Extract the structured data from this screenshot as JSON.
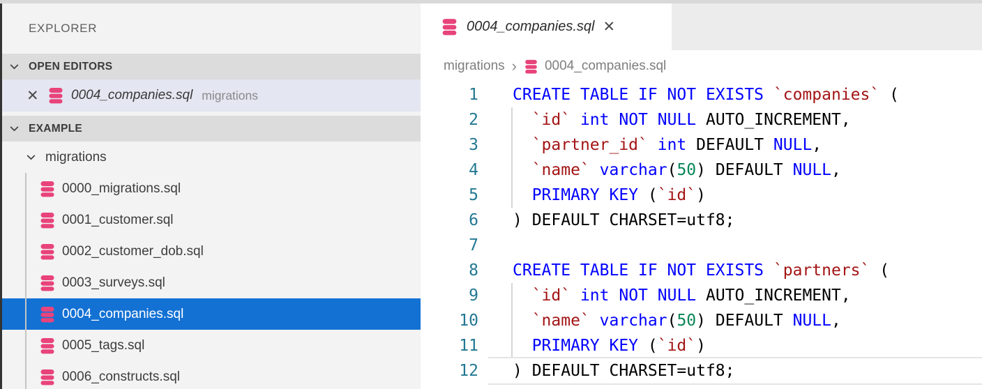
{
  "icons": {
    "close": "✕",
    "chevron_down": "chevron-down",
    "breadcrumb_separator": "›",
    "file_icon": "database-icon"
  },
  "colors": {
    "selection_blue": "#1371d4",
    "open_editor_selection": "#e4e6f1",
    "database_icon_pink": "#e8437a",
    "keyword_blue": "#0000ff",
    "identifier_red": "#a31515",
    "number_green": "#098658",
    "line_number_teal": "#237893",
    "sidebar_bg": "#f3f3f3",
    "section_header_bg": "#dcdcdc",
    "tabstrip_bg": "#ececec"
  },
  "sidebar": {
    "title": "EXPLORER",
    "sections": [
      {
        "label": "OPEN EDITORS"
      },
      {
        "label": "EXAMPLE"
      }
    ],
    "open_editor": {
      "file": "0004_companies.sql",
      "folder": "migrations"
    },
    "tree": {
      "folder": "migrations",
      "selected_index": 4,
      "files": [
        "0000_migrations.sql",
        "0001_customer.sql",
        "0002_customer_dob.sql",
        "0003_surveys.sql",
        "0004_companies.sql",
        "0005_tags.sql",
        "0006_constructs.sql"
      ]
    }
  },
  "editor": {
    "tab": {
      "title": "0004_companies.sql"
    },
    "breadcrumb": {
      "folder": "migrations",
      "separator": "›",
      "file": "0004_companies.sql"
    },
    "code": {
      "lines": [
        {
          "no": "1",
          "guide": false,
          "current": false,
          "tokens": [
            [
              "kw",
              "CREATE TABLE IF NOT EXISTS"
            ],
            [
              "pl",
              " "
            ],
            [
              "id",
              "`companies`"
            ],
            [
              "pl",
              " ("
            ]
          ]
        },
        {
          "no": "2",
          "guide": true,
          "current": false,
          "tokens": [
            [
              "pl",
              "  "
            ],
            [
              "id",
              "`id`"
            ],
            [
              "pl",
              " "
            ],
            [
              "kw",
              "int"
            ],
            [
              "pl",
              " "
            ],
            [
              "kw",
              "NOT NULL"
            ],
            [
              "pl",
              " AUTO_INCREMENT,"
            ]
          ]
        },
        {
          "no": "3",
          "guide": true,
          "current": false,
          "tokens": [
            [
              "pl",
              "  "
            ],
            [
              "id",
              "`partner_id`"
            ],
            [
              "pl",
              " "
            ],
            [
              "kw",
              "int"
            ],
            [
              "pl",
              " DEFAULT "
            ],
            [
              "kw",
              "NULL"
            ],
            [
              "pl",
              ","
            ]
          ]
        },
        {
          "no": "4",
          "guide": true,
          "current": false,
          "tokens": [
            [
              "pl",
              "  "
            ],
            [
              "id",
              "`name`"
            ],
            [
              "pl",
              " "
            ],
            [
              "kw",
              "varchar"
            ],
            [
              "pl",
              "("
            ],
            [
              "num",
              "50"
            ],
            [
              "pl",
              ") DEFAULT "
            ],
            [
              "kw",
              "NULL"
            ],
            [
              "pl",
              ","
            ]
          ]
        },
        {
          "no": "5",
          "guide": true,
          "current": false,
          "tokens": [
            [
              "pl",
              "  "
            ],
            [
              "kw",
              "PRIMARY KEY"
            ],
            [
              "pl",
              " ("
            ],
            [
              "id",
              "`id`"
            ],
            [
              "pl",
              ")"
            ]
          ]
        },
        {
          "no": "6",
          "guide": false,
          "current": false,
          "tokens": [
            [
              "pl",
              ") DEFAULT CHARSET=utf8;"
            ]
          ]
        },
        {
          "no": "7",
          "guide": false,
          "current": false,
          "tokens": []
        },
        {
          "no": "8",
          "guide": false,
          "current": false,
          "tokens": [
            [
              "kw",
              "CREATE TABLE IF NOT EXISTS"
            ],
            [
              "pl",
              " "
            ],
            [
              "id",
              "`partners`"
            ],
            [
              "pl",
              " ("
            ]
          ]
        },
        {
          "no": "9",
          "guide": true,
          "current": false,
          "tokens": [
            [
              "pl",
              "  "
            ],
            [
              "id",
              "`id`"
            ],
            [
              "pl",
              " "
            ],
            [
              "kw",
              "int"
            ],
            [
              "pl",
              " "
            ],
            [
              "kw",
              "NOT NULL"
            ],
            [
              "pl",
              " AUTO_INCREMENT,"
            ]
          ]
        },
        {
          "no": "10",
          "guide": true,
          "current": false,
          "tokens": [
            [
              "pl",
              "  "
            ],
            [
              "id",
              "`name`"
            ],
            [
              "pl",
              " "
            ],
            [
              "kw",
              "varchar"
            ],
            [
              "pl",
              "("
            ],
            [
              "num",
              "50"
            ],
            [
              "pl",
              ") DEFAULT "
            ],
            [
              "kw",
              "NULL"
            ],
            [
              "pl",
              ","
            ]
          ]
        },
        {
          "no": "11",
          "guide": true,
          "current": false,
          "tokens": [
            [
              "pl",
              "  "
            ],
            [
              "kw",
              "PRIMARY KEY"
            ],
            [
              "pl",
              " ("
            ],
            [
              "id",
              "`id`"
            ],
            [
              "pl",
              ")"
            ]
          ]
        },
        {
          "no": "12",
          "guide": false,
          "current": true,
          "tokens": [
            [
              "pl",
              ") DEFAULT CHARSET=utf8;"
            ]
          ]
        }
      ]
    }
  }
}
